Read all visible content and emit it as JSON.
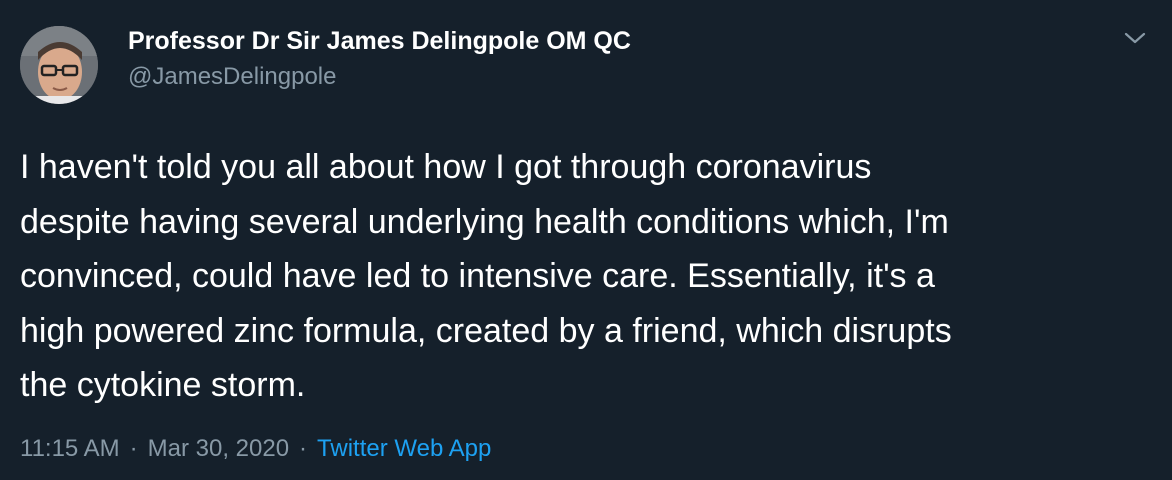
{
  "author": {
    "display_name": "Professor Dr Sir James Delingpole OM QC",
    "handle": "@JamesDelingpole"
  },
  "tweet": {
    "lines": [
      "I haven't told you all about how I got through coronavirus",
      "despite having several underlying health conditions which, I'm",
      "convinced, could have led to intensive care. Essentially, it's a",
      "high powered zinc formula, created by a friend, which disrupts",
      "the cytokine storm."
    ]
  },
  "meta": {
    "time": "11:15 AM",
    "separator": "·",
    "date": "Mar 30, 2020",
    "source": "Twitter Web App"
  },
  "icons": {
    "menu": "chevron-down-icon"
  },
  "colors": {
    "background": "#15202b",
    "text": "#ffffff",
    "secondary": "#8899a6",
    "link": "#1da1f2"
  }
}
